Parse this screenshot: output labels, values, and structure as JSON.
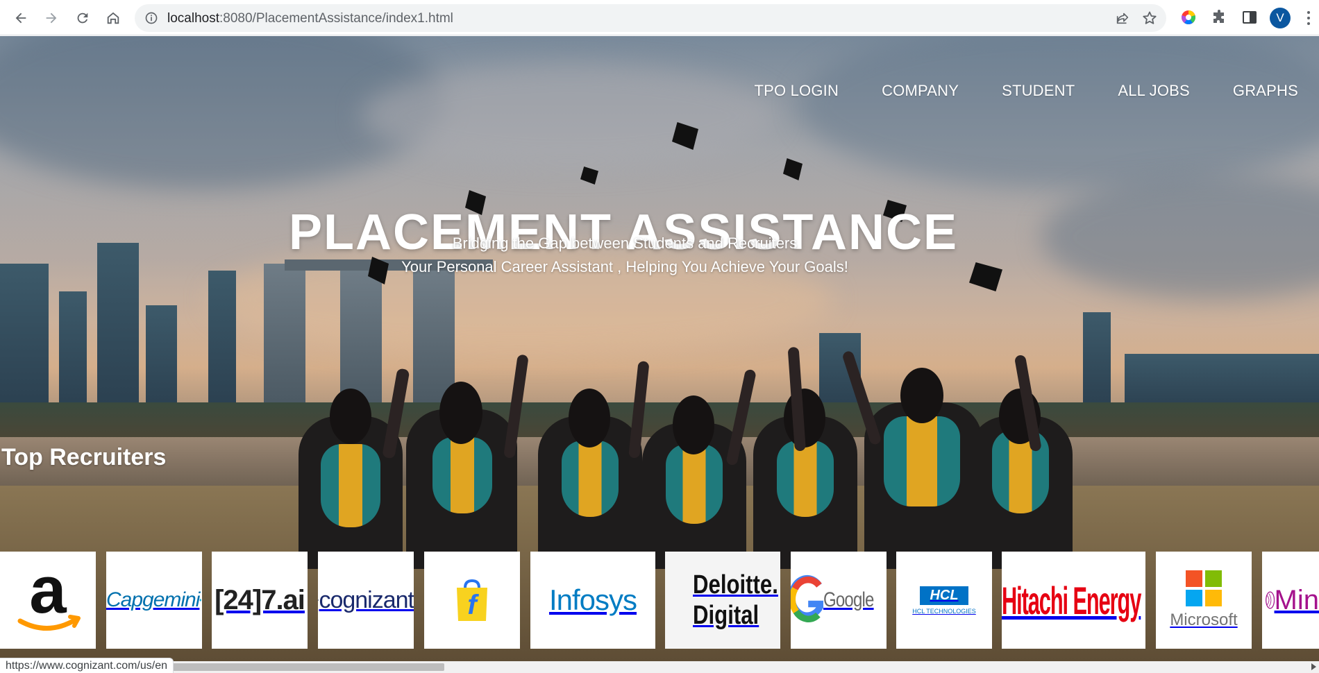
{
  "browser": {
    "url_host": "localhost",
    "url_path": ":8080/PlacementAssistance/index1.html",
    "profile_initial": "V",
    "status_url": "https://www.cognizant.com/us/en",
    "icons": [
      "back-icon",
      "forward-icon",
      "reload-icon",
      "home-icon",
      "site-info-icon",
      "share-icon",
      "bookmark-star-icon",
      "color-extension-icon",
      "puzzle-extensions-icon",
      "side-panel-icon",
      "kebab-menu-icon"
    ]
  },
  "nav": {
    "tpo_login": "TPO LOGIN",
    "company": "COMPANY",
    "student": "STUDENT",
    "all_jobs": "ALL JOBS",
    "graphs": "GRAPHS"
  },
  "hero": {
    "title": "PLACEMENT ASSISTANCE",
    "subtitle_1": "Bridging the Gap between Students and Recruiters",
    "subtitle_2": "Your Personal Career Assistant , Helping You Achieve Your Goals!"
  },
  "recruiters": {
    "title": "Top Recruiters",
    "logos": {
      "amazon": "a",
      "capgemini": "Capgemini",
      "247ai": "[24]7.ai",
      "cognizant": "cognizant",
      "flipkart": "f",
      "infosys": "Infosys",
      "deloitte_1": "Deloitte.",
      "deloitte_2": "Digital",
      "google": "Google",
      "hcl_1": "HCL",
      "hcl_2": "HCL TECHNOLOGIES",
      "hitachi": "Hitachi Energy",
      "microsoft": "Microsoft",
      "mindtree": "Min"
    }
  },
  "colors": {
    "avatar": "#0b57a0",
    "amazon_orange": "#ff9900",
    "capgemini_blue": "#0070ad",
    "cognizant_blue": "#1a2a6c",
    "flipkart_yellow": "#f8d21f",
    "infosys_blue": "#007cc3",
    "deloitte_green": "#86bc25",
    "hcl_blue": "#0072c6",
    "hitachi_red": "#e60012",
    "ms_red": "#f35325",
    "ms_green": "#81bc06",
    "ms_blue": "#05a6f0",
    "ms_yellow": "#ffba08",
    "mindtree_magenta": "#a4128c"
  }
}
